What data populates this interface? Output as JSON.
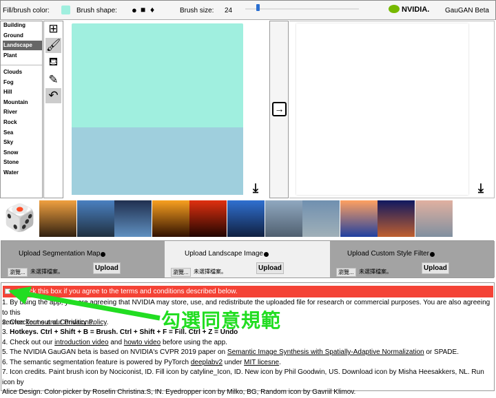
{
  "toolbar": {
    "fill_label": "Fill/brush color:",
    "fill_color": "#a0efdf",
    "shape_label": "Brush shape:",
    "shapes": [
      "●",
      "■",
      "♦"
    ],
    "size_label": "Brush size:",
    "size_value": "24",
    "size_slider_fraction": 0.1,
    "brand": "NVIDIA.",
    "app_title": "GauGAN Beta"
  },
  "labels": {
    "group1": [
      "Building",
      "Ground",
      "Landscape",
      "Plant"
    ],
    "selected": "Landscape",
    "group2": [
      "Clouds",
      "Fog",
      "Hill",
      "Mountain",
      "River",
      "Rock",
      "Sea",
      "Sky",
      "Snow",
      "Stone",
      "Water"
    ]
  },
  "tools": [
    "new-icon",
    "brush-icon",
    "fill-icon",
    "eyedropper-icon",
    "undo-icon"
  ],
  "canvas": {
    "top_color": "#a0efdf",
    "bottom_color": "#9fcfdd"
  },
  "upload": {
    "sections": [
      {
        "title": "Upload Segmentation Map",
        "browse": "瀏覽...",
        "nofile": "未選擇檔案。",
        "button": "Upload"
      },
      {
        "title": "Upload Landscape Image",
        "browse": "瀏覽...",
        "nofile": "未選擇檔案。",
        "button": "Upload"
      },
      {
        "title": "Upload Custom Style Filter",
        "browse": "瀏覽...",
        "nofile": "未選擇檔案。",
        "button": "Upload"
      }
    ]
  },
  "terms": {
    "checkbox_label": "Check this box if you agree to the terms and conditions described below.",
    "l1a": "1. By using the app, you are agreeing that NVIDIA may store, use, and redistribute the uploaded file for research or commercial purposes. You are also agreeing to this",
    "l1b": "service ",
    "l1link": "Terms and Conditions",
    "l1c": ".",
    "l2a": "2. Checkout out our ",
    "l2link": "Privacy Policy",
    "l2b": ".",
    "l3": "Hotkeys. Ctrl + Shift + B = Brush. Ctrl + Shift + F = Fill. Ctrl + Z = Undo",
    "l3n": "3. ",
    "l4a": "4. Check out our ",
    "l4link1": "introduction video",
    "l4b": " and ",
    "l4link2": "howto video",
    "l4c": " before using the app.",
    "l5a": "5. The NVIDIA GauGAN beta is based on NVIDIA's CVPR 2019 paper on ",
    "l5link": "Semantic Image Synthesis with Spatially-Adaptive Normalization",
    "l5b": " or SPADE.",
    "l6a": "6. The semantic segmentation feature is powered by PyTorch ",
    "l6link1": "deeplabv2",
    "l6b": " under ",
    "l6link2": "MIT licesne",
    "l6c": ".",
    "l7a": "7. Icon credits. Paint brush icon by Nociconist, ID. Fill icon by catyline_Icon, ID. New icon by Phil Goodwin, US. Download icon by Misha Heesakkers, NL. Run icon by",
    "l7b": "Alice Design. Color-picker by Roselin Christina.S, IN. Eyedropper icon by Milko, BG, Random icon by Gavriil Klimov."
  },
  "annotation": {
    "text": "勾選同意規範",
    "color": "#22dd22"
  }
}
